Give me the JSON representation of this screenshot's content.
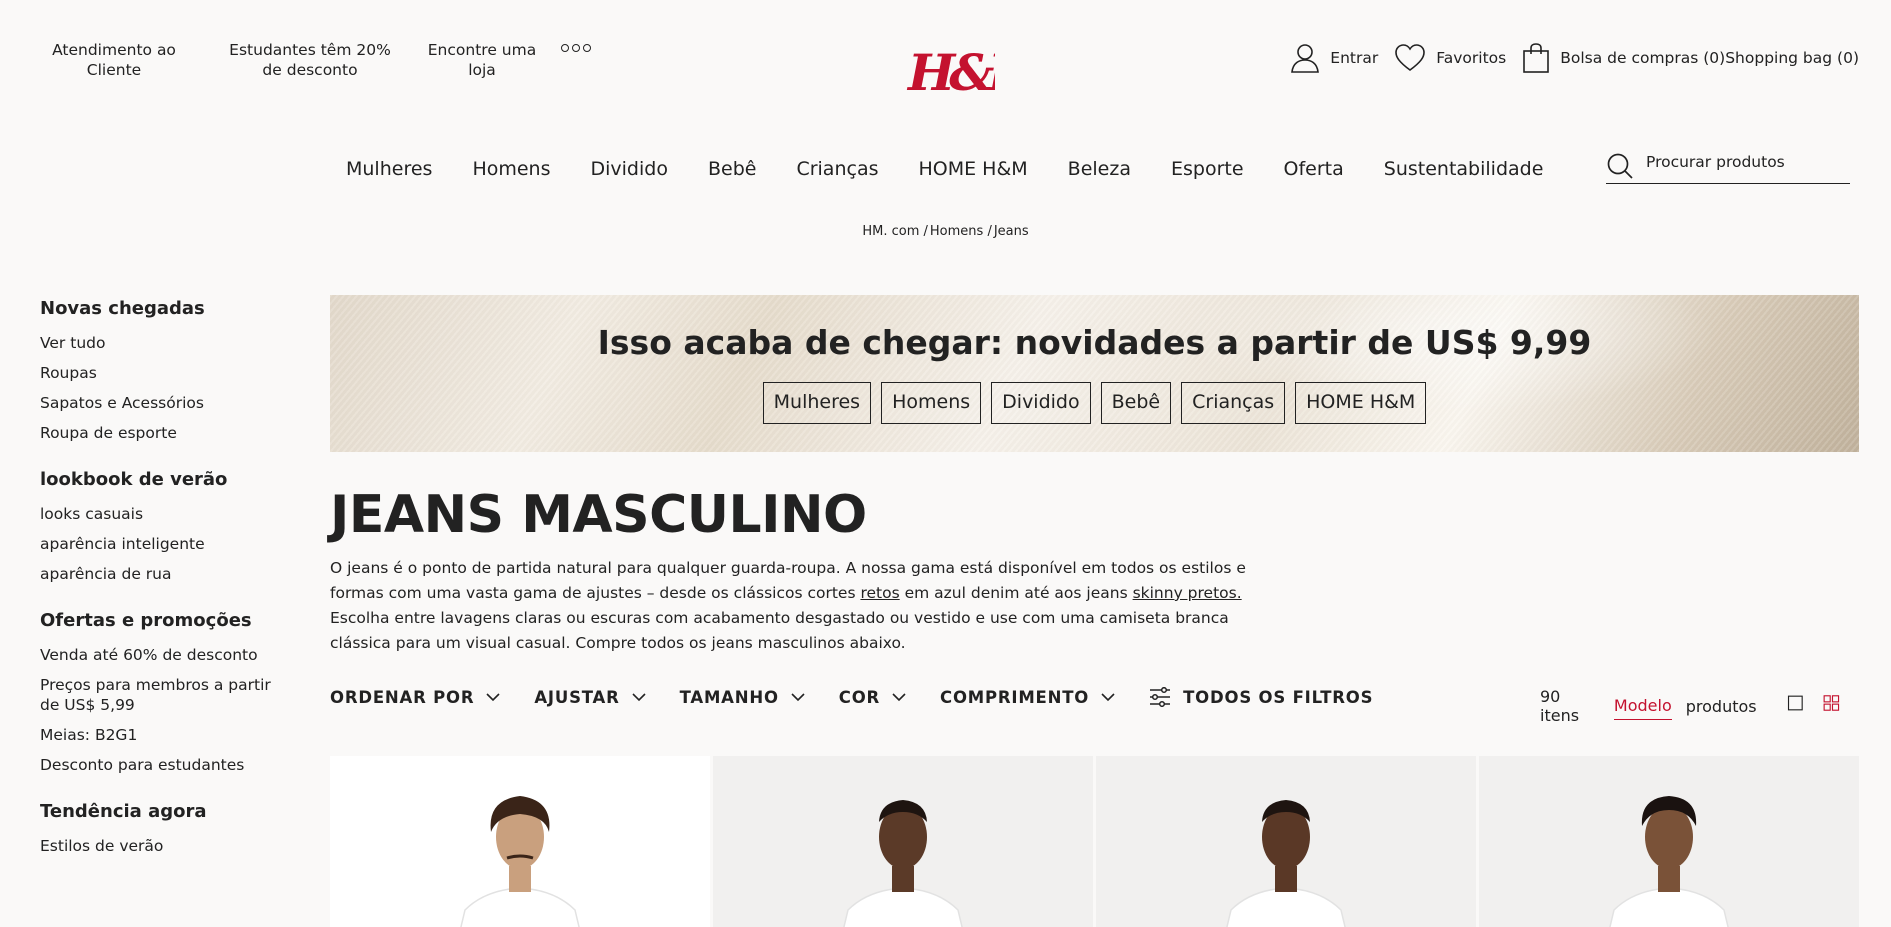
{
  "utility": {
    "customer_service": "Atendimento ao Cliente",
    "student_discount": "Estudantes têm 20% de desconto",
    "find_store": "Encontre uma loja"
  },
  "brand": {
    "logo_text": "H&M",
    "accent_color": "#c4122f"
  },
  "account": {
    "sign_in": "Entrar",
    "favorites": "Favoritos",
    "bag": "Bolsa de compras (0)Shopping bag (0)"
  },
  "nav": {
    "items": [
      "Mulheres",
      "Homens",
      "Dividido",
      "Bebê",
      "Crianças",
      "HOME H&M",
      "Beleza",
      "Esporte",
      "Oferta",
      "Sustentabilidade"
    ]
  },
  "search": {
    "placeholder": "Procurar produtos"
  },
  "breadcrumb": [
    "HM. com /",
    "Homens /",
    "Jeans"
  ],
  "sidebar": {
    "groups": [
      {
        "title": "Novas chegadas",
        "links": [
          "Ver tudo",
          "Roupas",
          "Sapatos e Acessórios",
          "Roupa de esporte"
        ]
      },
      {
        "title": "lookbook de verão",
        "links": [
          "looks casuais",
          "aparência inteligente",
          "aparência de rua"
        ]
      },
      {
        "title": "Ofertas e promoções",
        "links": [
          "Venda até 60% de desconto",
          "Preços para membros a partir de US$ 5,99",
          "Meias: B2G1",
          "Desconto para estudantes"
        ]
      },
      {
        "title": "Tendência agora",
        "links": [
          "Estilos de verão"
        ]
      }
    ]
  },
  "banner": {
    "title": "Isso acaba de chegar: novidades a partir de US$ 9,99",
    "buttons": [
      "Mulheres",
      "Homens",
      "Dividido",
      "Bebê",
      "Crianças",
      "HOME H&M"
    ]
  },
  "page": {
    "title": "JEANS MASCULINO",
    "description": {
      "part1": "O jeans é o ponto de partida natural para qualquer guarda-roupa. A nossa gama está disponível em todos os estilos e formas com uma vasta gama de ajustes – desde os clássicos cortes ",
      "link1": "retos",
      "part2": " em azul denim até aos jeans ",
      "link2": "skinny pretos.",
      "part3": " Escolha entre lavagens claras ou escuras com acabamento desgastado ou vestido e use com uma camiseta branca clássica para um visual casual. Compre todos os jeans masculinos abaixo."
    }
  },
  "filters": {
    "sort": "ORDENAR POR",
    "fit": "AJUSTAR",
    "size": "TAMANHO",
    "color": "COR",
    "length": "COMPRIMENTO",
    "all": "TODOS OS FILTROS"
  },
  "results": {
    "count": "90 itens",
    "tab_model": "Modelo",
    "tab_product": "produtos"
  },
  "products": [
    {
      "skin": "#c9a07e",
      "hair": "#3a2418"
    },
    {
      "skin": "#5b3a28",
      "hair": "#1e1410"
    },
    {
      "skin": "#5a3826",
      "hair": "#1e1410"
    },
    {
      "skin": "#7a5238",
      "hair": "#1a1210"
    }
  ]
}
